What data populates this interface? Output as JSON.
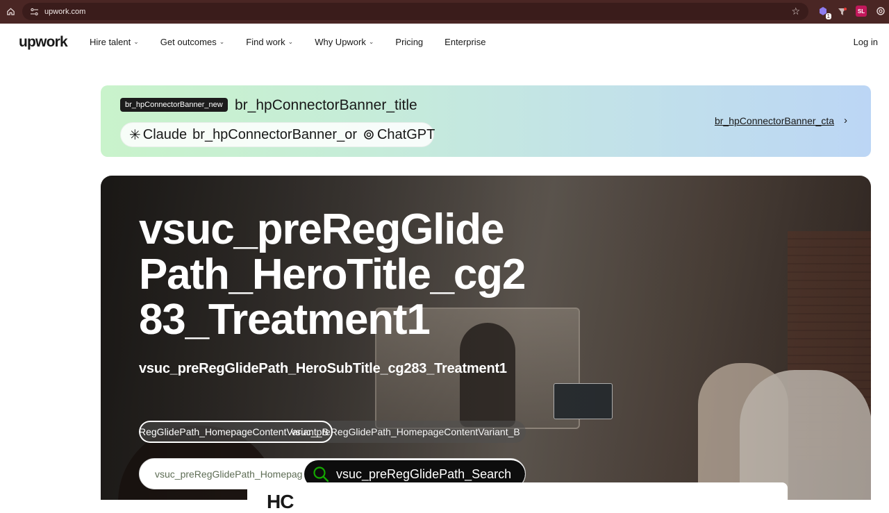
{
  "browser": {
    "url": "upwork.com",
    "extension_badge": "1",
    "profile_initials": "SL"
  },
  "header": {
    "logo": "upwork",
    "nav": [
      {
        "label": "Hire talent",
        "has_dropdown": true
      },
      {
        "label": "Get outcomes",
        "has_dropdown": true
      },
      {
        "label": "Find work",
        "has_dropdown": true
      },
      {
        "label": "Why Upwork",
        "has_dropdown": true
      },
      {
        "label": "Pricing",
        "has_dropdown": false
      },
      {
        "label": "Enterprise",
        "has_dropdown": false
      }
    ],
    "login": "Log in"
  },
  "banner": {
    "badge": "br_hpConnectorBanner_new",
    "title": "br_hpConnectorBanner_title",
    "claude": "Claude",
    "or": "br_hpConnectorBanner_or",
    "chatgpt": "ChatGPT",
    "cta": "br_hpConnectorBanner_cta"
  },
  "hero": {
    "title": "vsuc_preRegGlidePath_HeroTitle_cg283_Treatment1",
    "subtitle": "vsuc_preRegGlidePath_HeroSubTitle_cg283_Treatment1",
    "toggle_option_1": "RegGlidePath_HomepageContentVariant_B",
    "toggle_option_2": "vsuc_preRegGlidePath_HomepageContentVariant_B",
    "search_placeholder": "vsuc_preRegGlidePath_Homepag",
    "search_button": "vsuc_preRegGlidePath_Search"
  },
  "bottom_card": {
    "glyph": "HC"
  },
  "colors": {
    "browser_bar": "#4a2624",
    "banner_left": "#c9f3cb",
    "banner_right": "#bcd6f5",
    "search_icon": "#14a800"
  }
}
